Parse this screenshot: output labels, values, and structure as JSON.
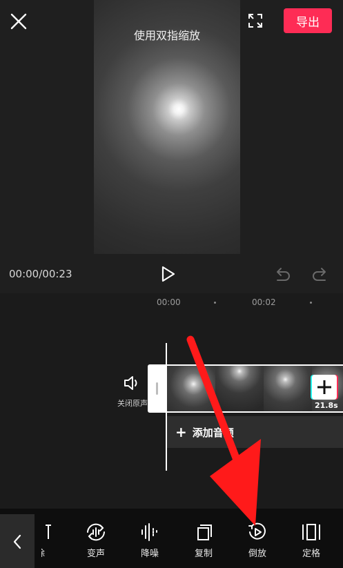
{
  "header": {
    "export_label": "导出",
    "preview_hint": "使用双指缩放"
  },
  "player": {
    "timecode": "00:00/00:23"
  },
  "timeline": {
    "ticks": [
      "00:00",
      "00:02"
    ],
    "mute_label": "关闭原声",
    "clip_duration": "21.8s",
    "add_audio_label": "添加音频"
  },
  "toolbar": {
    "partial_label": "除",
    "tools": [
      {
        "label": "变声",
        "icon": "voice-change-icon"
      },
      {
        "label": "降噪",
        "icon": "noise-reduction-icon"
      },
      {
        "label": "复制",
        "icon": "copy-icon"
      },
      {
        "label": "倒放",
        "icon": "reverse-play-icon"
      },
      {
        "label": "定格",
        "icon": "freeze-frame-icon"
      }
    ]
  },
  "colors": {
    "accent": "#fe2c55",
    "annotation_arrow": "#ff1a1a",
    "background": "#1b1b1b",
    "toolbar": "#0e0e0e"
  }
}
